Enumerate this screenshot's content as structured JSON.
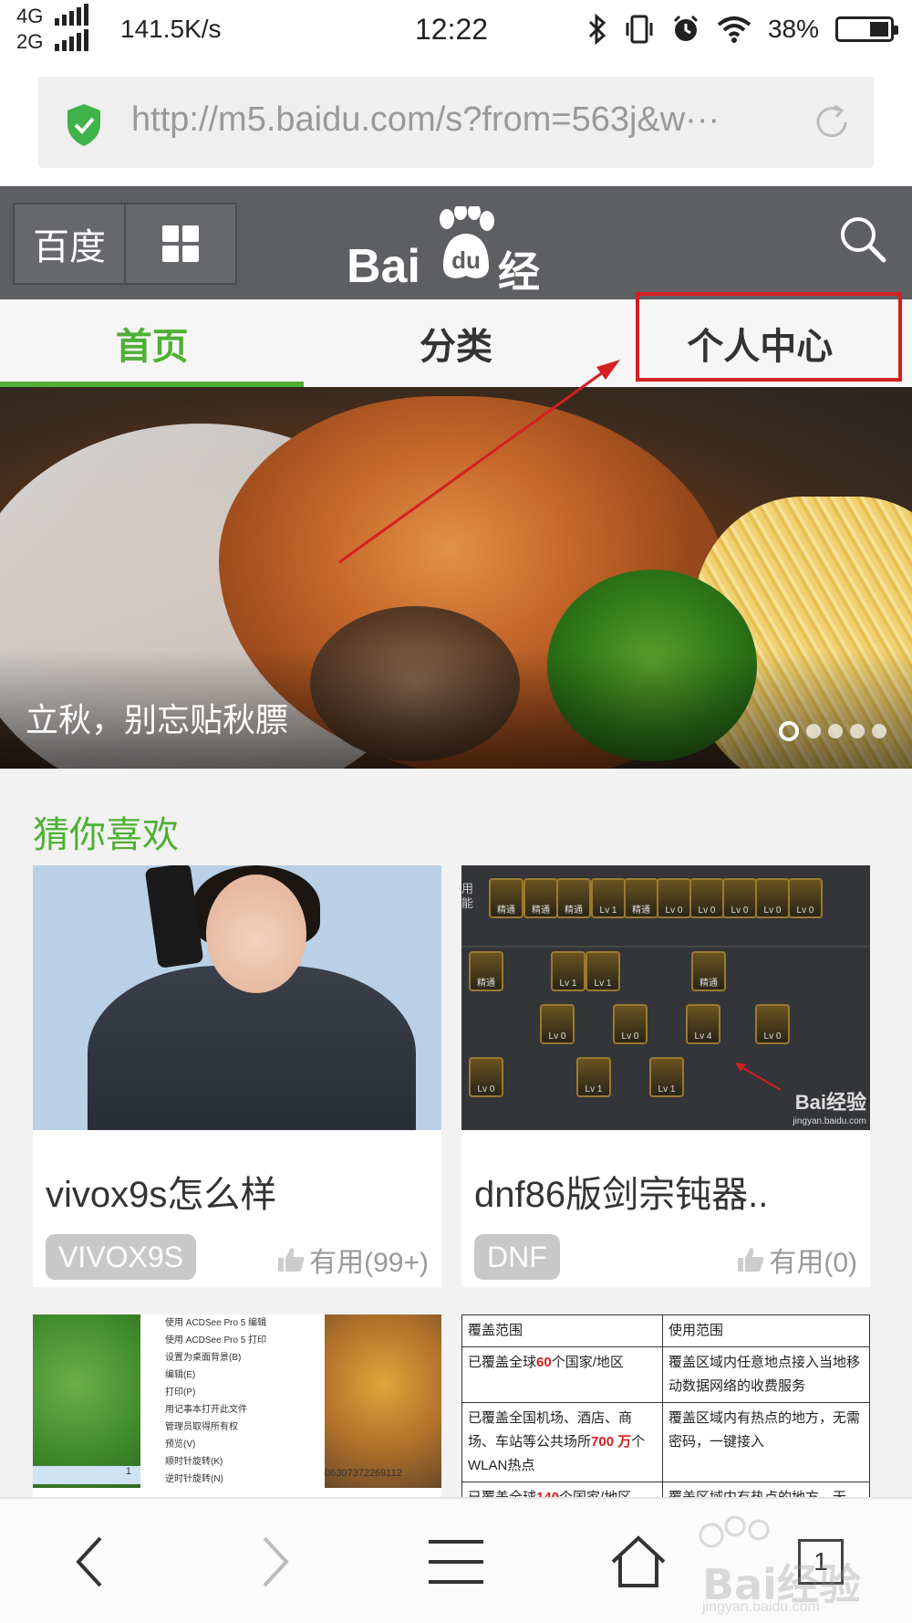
{
  "status_bar": {
    "net_top": "4G",
    "net_bottom": "2G",
    "speed": "141.5K/s",
    "time": "12:22",
    "battery": "38%",
    "battery_level": 0.38
  },
  "browser": {
    "url": "http://m5.baidu.com/s?from=563j&w···"
  },
  "header": {
    "home_button": "百度",
    "logo_text_left": "Bai",
    "logo_text_paw": "du",
    "logo_text_right": "经验"
  },
  "tabs": [
    {
      "label": "首页",
      "active": true
    },
    {
      "label": "分类",
      "active": false
    },
    {
      "label": "个人中心",
      "active": false
    }
  ],
  "banner": {
    "caption": "立秋，别忘贴秋膘",
    "slide_count": 5,
    "current_slide": 1
  },
  "section": {
    "title": "猜你喜欢"
  },
  "cards": [
    {
      "title": "vivox9s怎么样",
      "tag": "VIVOX9S",
      "useful": "有用(99+)"
    },
    {
      "title": "dnf86版剑宗钝器..",
      "tag": "DNF",
      "useful": "有用(0)"
    }
  ],
  "acdsee_menu": [
    "使用 ACDSee Pro 5 编辑",
    "使用 ACDSee Pro 5 打印",
    "设置为桌面背景(B)",
    "编辑(E)",
    "打印(P)",
    "用记事本打开此文件",
    "管理员取得所有权",
    "预览(V)",
    "顺时针旋转(K)",
    "逆时针旋转(N)"
  ],
  "acdsee_caption": "06307372269112",
  "acdsee_number": "1",
  "coverage_table": {
    "headers": [
      "覆盖范围",
      "使用范围"
    ],
    "rows": [
      [
        "已覆盖全球",
        "60",
        "个国家/地区",
        "覆盖区域内任意地点接入当地移动数据网络的收费服务"
      ],
      [
        "已覆盖全国机场、酒店、商场、车站等公共场所",
        "700 万",
        "个WLAN热点",
        "覆盖区域内有热点的地方，无需密码，一键接入"
      ],
      [
        "已覆盖全球",
        "140",
        "个国家/地区、",
        "覆盖区域内有热点的地方，无"
      ]
    ]
  },
  "game_side_label": "用能",
  "game_levels": {
    "row1": [
      "精通",
      "精通",
      "精通",
      "Lv 1",
      "精通",
      "Lv 0",
      "Lv 0",
      "Lv 0",
      "Lv 0",
      "Lv 0"
    ],
    "row2": [
      "精通",
      "Lv 1",
      "Lv 1",
      "精通"
    ],
    "row3": [
      "Lv 0",
      "Lv 0",
      "Lv 4",
      "Lv 0"
    ],
    "row4": [
      "Lv 0",
      "Lv 1",
      "Lv 1"
    ]
  },
  "game_watermark": "Bai经验",
  "game_watermark_sub": "jingyan.baidu.com",
  "bottom_nav": {
    "tab_count": "1"
  },
  "watermark": {
    "text": "Bai经验",
    "sub": "jingyan.baidu.com"
  },
  "colors": {
    "accent_green": "#4fb034",
    "header_gray": "#5d5f62",
    "annotation_red": "#d42020"
  }
}
